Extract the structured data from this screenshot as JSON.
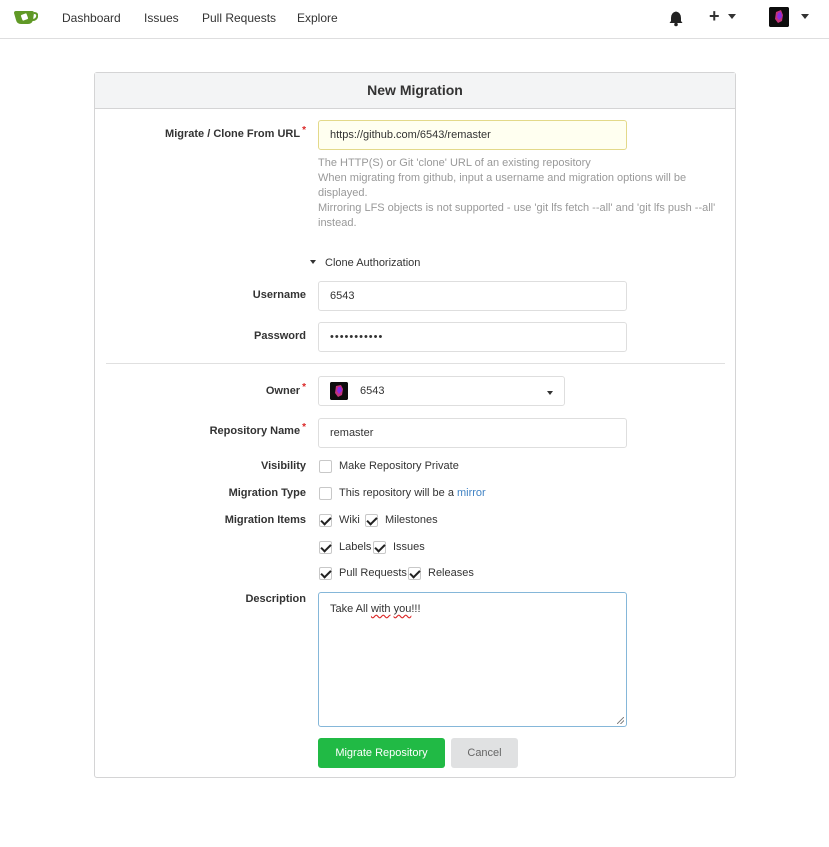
{
  "nav": {
    "items": [
      "Dashboard",
      "Issues",
      "Pull Requests",
      "Explore"
    ]
  },
  "form": {
    "title": "New Migration",
    "clone_url": {
      "label": "Migrate / Clone From URL",
      "value": "https://github.com/6543/remaster",
      "help": [
        "The HTTP(S) or Git 'clone' URL of an existing repository",
        "When migrating from github, input a username and migration options will be displayed.",
        "Mirroring LFS objects is not supported - use 'git lfs fetch --all' and 'git lfs push --all' instead."
      ]
    },
    "auth_toggle": "Clone Authorization",
    "username": {
      "label": "Username",
      "value": "6543"
    },
    "password": {
      "label": "Password",
      "value": "•••••••••••"
    },
    "owner": {
      "label": "Owner",
      "value": "6543"
    },
    "repo_name": {
      "label": "Repository Name",
      "value": "remaster"
    },
    "visibility": {
      "label": "Visibility",
      "option": "Make Repository Private",
      "checked": false
    },
    "migration_type": {
      "label": "Migration Type",
      "option_prefix": "This repository will be a",
      "option_link": "mirror",
      "checked": false
    },
    "migration_items": {
      "label": "Migration Items",
      "items": [
        {
          "label": "Wiki",
          "checked": true
        },
        {
          "label": "Milestones",
          "checked": true
        },
        {
          "label": "Labels",
          "checked": true
        },
        {
          "label": "Issues",
          "checked": true
        },
        {
          "label": "Pull Requests",
          "checked": true
        },
        {
          "label": "Releases",
          "checked": true
        }
      ]
    },
    "description": {
      "label": "Description",
      "prefix": "Take All ",
      "w1": "with",
      "w2": "you",
      "suffix": "!!!"
    },
    "submit": "Migrate Repository",
    "cancel": "Cancel"
  },
  "colors": {
    "primary": "#21ba45",
    "link": "#4183c4",
    "required": "#db2828"
  }
}
